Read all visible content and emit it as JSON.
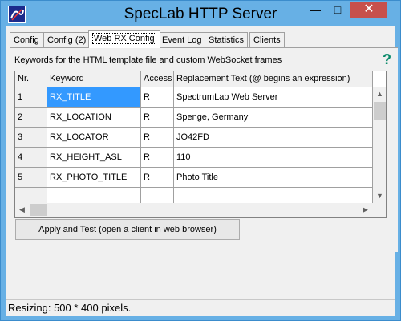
{
  "window": {
    "title": "SpecLab HTTP Server"
  },
  "tabs": [
    {
      "label": "Config"
    },
    {
      "label": "Config (2)"
    },
    {
      "label": "Web RX Config"
    },
    {
      "label": "Event Log"
    },
    {
      "label": "Statistics"
    },
    {
      "label": "Clients"
    }
  ],
  "active_tab": "Web RX Config",
  "description": "Keywords for the HTML template file and custom WebSocket  frames",
  "help_icon": "question-icon",
  "grid": {
    "columns": [
      "Nr.",
      "Keyword",
      "Access",
      "Replacement Text (@ begins an expression)"
    ],
    "rows": [
      {
        "nr": "1",
        "keyword": "RX_TITLE",
        "access": "R",
        "text": "SpectrumLab Web Server"
      },
      {
        "nr": "2",
        "keyword": "RX_LOCATION",
        "access": "R",
        "text": "Spenge, Germany"
      },
      {
        "nr": "3",
        "keyword": "RX_LOCATOR",
        "access": "R",
        "text": "JO42FD"
      },
      {
        "nr": "4",
        "keyword": "RX_HEIGHT_ASL",
        "access": "R",
        "text": "110"
      },
      {
        "nr": "5",
        "keyword": "RX_PHOTO_TITLE",
        "access": "R",
        "text": "Photo Title"
      }
    ],
    "selected_cell": "RX_TITLE"
  },
  "apply_button": "Apply and Test (open a client in web browser)",
  "status_text": "Resizing: 500 * 400 pixels.",
  "colors": {
    "titlebar": "#67b0e5",
    "close": "#c7504c",
    "selection": "#3399ff",
    "help": "#0a8a6a"
  }
}
